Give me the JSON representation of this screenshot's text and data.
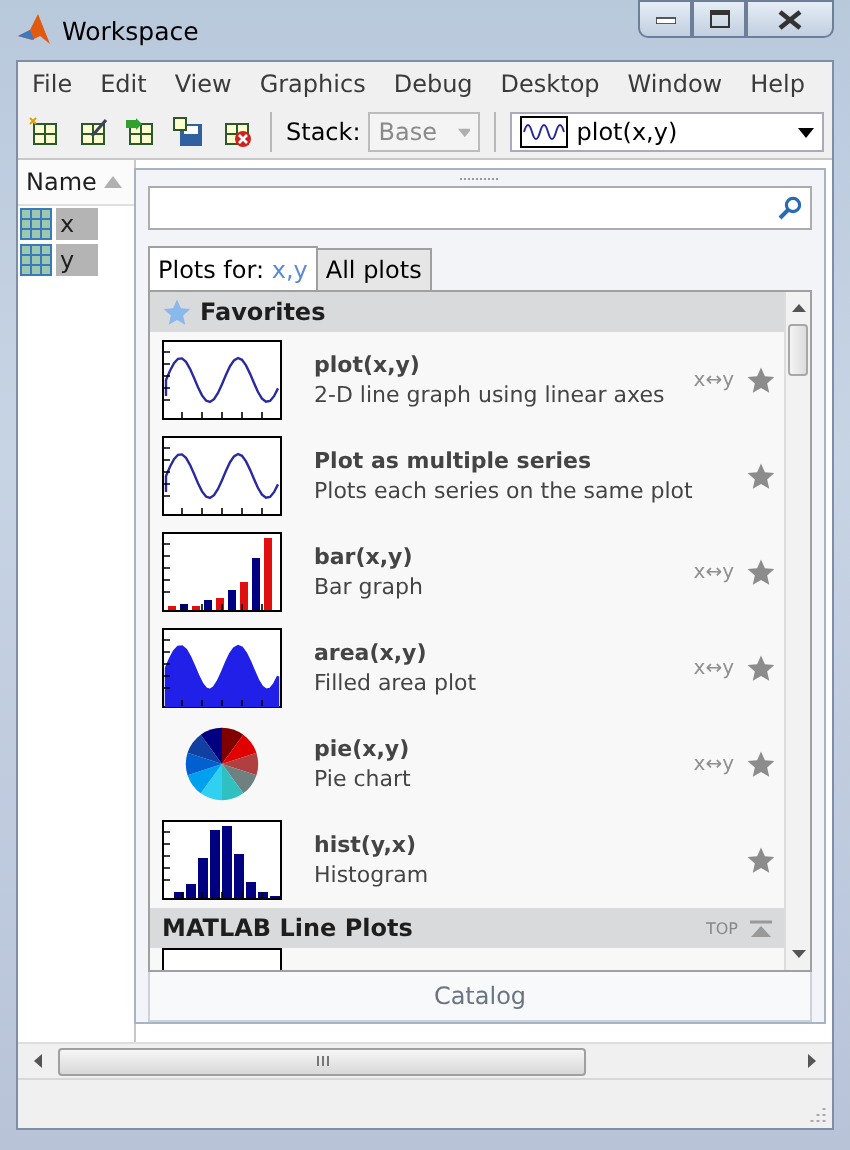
{
  "window": {
    "title": "Workspace"
  },
  "menu": [
    "File",
    "Edit",
    "View",
    "Graphics",
    "Debug",
    "Desktop",
    "Window",
    "Help"
  ],
  "toolbar": {
    "stack_label": "Stack:",
    "stack": {
      "value": "Base",
      "disabled": true
    },
    "plot_selector": "plot(x,y)"
  },
  "variables": {
    "column": "Name",
    "rows": [
      {
        "name": "x",
        "selected": true
      },
      {
        "name": "y",
        "selected": true
      }
    ]
  },
  "catalog": {
    "title": "Catalog",
    "tabs": [
      {
        "label": "Plots for: ",
        "vars": "x,y",
        "selected": true
      },
      {
        "label": "All plots",
        "selected": false
      }
    ],
    "sections": [
      {
        "title": "Favorites",
        "kind": "favorites",
        "items": [
          {
            "title": "plot(x,y)",
            "description": "2-D line graph using linear axes",
            "kind": "line",
            "swap": "x↔y"
          },
          {
            "title": "Plot as multiple series",
            "description": "Plots each series on the same plot",
            "kind": "line"
          },
          {
            "title": "bar(x,y)",
            "description": "Bar graph",
            "kind": "bar",
            "swap": "x↔y"
          },
          {
            "title": "area(x,y)",
            "description": "Filled area plot",
            "kind": "area",
            "swap": "x↔y"
          },
          {
            "title": "pie(x,y)",
            "description": "Pie chart",
            "kind": "pie",
            "swap": "x↔y"
          },
          {
            "title": "hist(y,x)",
            "description": "Histogram",
            "kind": "hist"
          }
        ]
      },
      {
        "title": "MATLAB Line Plots",
        "kind": "category",
        "top_label": "TOP",
        "items": [
          {
            "kind": "blank"
          }
        ]
      }
    ]
  }
}
